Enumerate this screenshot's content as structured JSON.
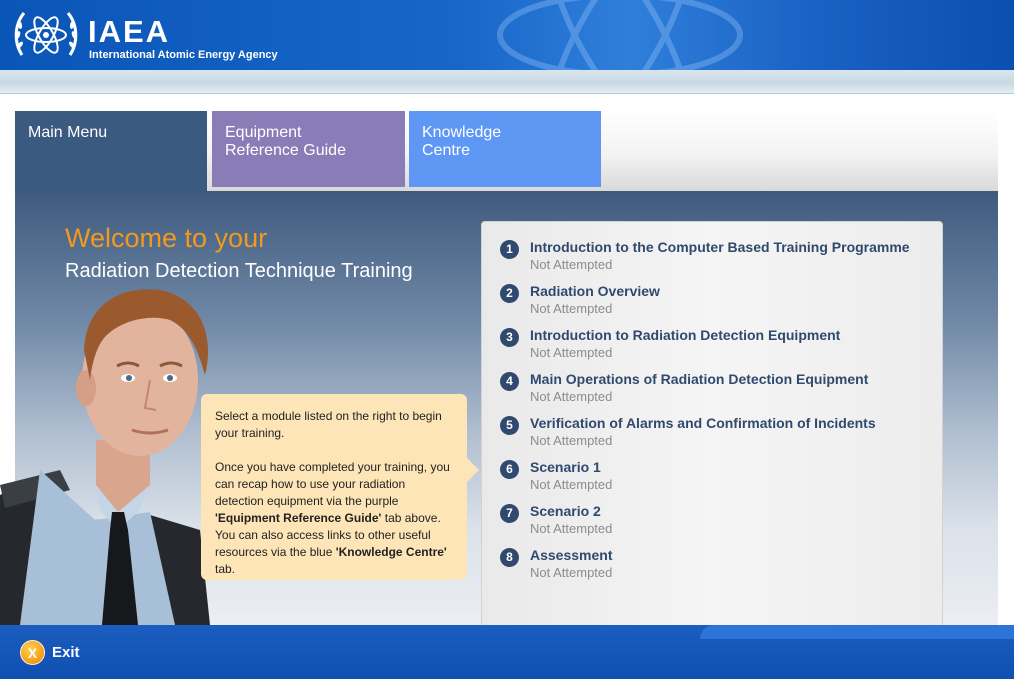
{
  "header": {
    "logo_text": "IAEA",
    "subtitle": "International Atomic Energy Agency"
  },
  "tabs": [
    {
      "label_line1": "Main Menu",
      "label_line2": "",
      "color": "#3b5a80"
    },
    {
      "label_line1": "Equipment",
      "label_line2": "Reference Guide",
      "color": "#8a7db7"
    },
    {
      "label_line1": "Knowledge",
      "label_line2": "Centre",
      "color": "#5f97f5"
    }
  ],
  "welcome": {
    "line1": "Welcome to your",
    "line2": "Radiation Detection Technique Training",
    "accent_color": "#f29a1e"
  },
  "bubble": {
    "para1": "Select a module listed on the right to begin your training.",
    "para2_a": "Once you have completed your training, you can recap how to use your radiation detection equipment via the purple ",
    "para2_b": "'Equipment Reference Guide'",
    "para2_c": " tab above. You can also access links to other useful resources via the blue ",
    "para2_d": "'Knowledge Centre'",
    "para2_e": " tab."
  },
  "modules": [
    {
      "number": "1",
      "title": "Introduction to the Computer Based Training Programme",
      "status": "Not Attempted"
    },
    {
      "number": "2",
      "title": "Radiation Overview",
      "status": "Not Attempted"
    },
    {
      "number": "3",
      "title": "Introduction to Radiation Detection Equipment",
      "status": "Not Attempted"
    },
    {
      "number": "4",
      "title": "Main Operations of Radiation Detection Equipment",
      "status": "Not Attempted"
    },
    {
      "number": "5",
      "title": "Verification of Alarms and Confirmation of Incidents",
      "status": "Not Attempted"
    },
    {
      "number": "6",
      "title": "Scenario 1",
      "status": "Not Attempted"
    },
    {
      "number": "7",
      "title": "Scenario 2",
      "status": "Not Attempted"
    },
    {
      "number": "8",
      "title": "Assessment",
      "status": "Not Attempted"
    }
  ],
  "footer": {
    "exit_icon_glyph": "X",
    "exit_label": "Exit"
  }
}
